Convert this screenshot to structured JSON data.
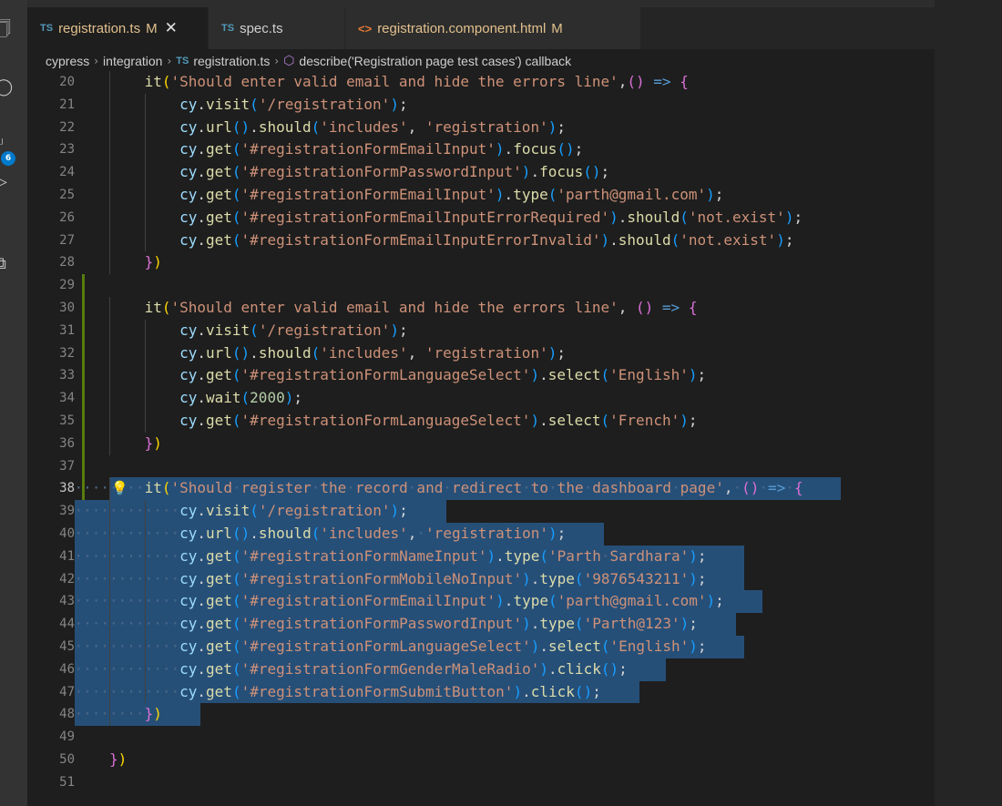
{
  "tabs": [
    {
      "badge": "TS",
      "label": "registration.ts",
      "modified": "M",
      "active": true,
      "close": "✕"
    },
    {
      "badge": "TS",
      "label": "spec.ts",
      "modified": "",
      "active": false
    },
    {
      "badge": "<>",
      "label": "registration.component.html",
      "modified": "M",
      "active": false
    }
  ],
  "breadcrumb": {
    "segments": [
      "cypress",
      "integration",
      "registration.ts",
      "describe('Registration page test cases') callback"
    ]
  },
  "activity_bar": {
    "source_control_badge": "6"
  },
  "colors": {
    "selection": "#264f78",
    "modified_tab_text": "#e2c08d",
    "gutter_modified": "#587c0c"
  },
  "editor": {
    "current_line": 38,
    "lines": [
      {
        "n": 20,
        "indent": 2,
        "tokens": [
          [
            "k",
            "it"
          ],
          [
            "p1",
            "("
          ],
          [
            "s",
            "'Should enter valid email and hide the errors line'"
          ],
          [
            "",
            ","
          ],
          [
            "p2",
            "()"
          ],
          [
            "",
            " "
          ],
          [
            "op",
            "=>"
          ],
          [
            "",
            " "
          ],
          [
            "p2",
            "{"
          ]
        ]
      },
      {
        "n": 21,
        "indent": 3,
        "tokens": [
          [
            "v",
            "cy"
          ],
          [
            "",
            "."
          ],
          [
            "k",
            "visit"
          ],
          [
            "p3",
            "("
          ],
          [
            "s",
            "'/registration'"
          ],
          [
            "p3",
            ")"
          ],
          [
            "",
            ";"
          ]
        ]
      },
      {
        "n": 22,
        "indent": 3,
        "tokens": [
          [
            "v",
            "cy"
          ],
          [
            "",
            "."
          ],
          [
            "k",
            "url"
          ],
          [
            "p3",
            "()"
          ],
          [
            "",
            "."
          ],
          [
            "k",
            "should"
          ],
          [
            "p3",
            "("
          ],
          [
            "s",
            "'includes'"
          ],
          [
            ", ",
            ""
          ],
          [
            "s",
            "'registration'"
          ],
          [
            "p3",
            ")"
          ],
          [
            "",
            ";"
          ]
        ]
      },
      {
        "n": 23,
        "indent": 3,
        "tokens": [
          [
            "v",
            "cy"
          ],
          [
            "",
            "."
          ],
          [
            "k",
            "get"
          ],
          [
            "p3",
            "("
          ],
          [
            "s",
            "'#registrationFormEmailInput'"
          ],
          [
            "p3",
            ")"
          ],
          [
            "",
            "."
          ],
          [
            "k",
            "focus"
          ],
          [
            "p3",
            "()"
          ],
          [
            "",
            ";"
          ]
        ]
      },
      {
        "n": 24,
        "indent": 3,
        "tokens": [
          [
            "v",
            "cy"
          ],
          [
            "",
            "."
          ],
          [
            "k",
            "get"
          ],
          [
            "p3",
            "("
          ],
          [
            "s",
            "'#registrationFormPasswordInput'"
          ],
          [
            "p3",
            ")"
          ],
          [
            "",
            "."
          ],
          [
            "k",
            "focus"
          ],
          [
            "p3",
            "()"
          ],
          [
            "",
            ";"
          ]
        ]
      },
      {
        "n": 25,
        "indent": 3,
        "tokens": [
          [
            "v",
            "cy"
          ],
          [
            "",
            "."
          ],
          [
            "k",
            "get"
          ],
          [
            "p3",
            "("
          ],
          [
            "s",
            "'#registrationFormEmailInput'"
          ],
          [
            "p3",
            ")"
          ],
          [
            "",
            "."
          ],
          [
            "k",
            "type"
          ],
          [
            "p3",
            "("
          ],
          [
            "s",
            "'parth@gmail.com'"
          ],
          [
            "p3",
            ")"
          ],
          [
            "",
            ";"
          ]
        ]
      },
      {
        "n": 26,
        "indent": 3,
        "tokens": [
          [
            "v",
            "cy"
          ],
          [
            "",
            "."
          ],
          [
            "k",
            "get"
          ],
          [
            "p3",
            "("
          ],
          [
            "s",
            "'#registrationFormEmailInputErrorRequired'"
          ],
          [
            "p3",
            ")"
          ],
          [
            "",
            "."
          ],
          [
            "k",
            "should"
          ],
          [
            "p3",
            "("
          ],
          [
            "s",
            "'not.exist'"
          ],
          [
            "p3",
            ")"
          ],
          [
            "",
            ";"
          ]
        ]
      },
      {
        "n": 27,
        "indent": 3,
        "tokens": [
          [
            "v",
            "cy"
          ],
          [
            "",
            "."
          ],
          [
            "k",
            "get"
          ],
          [
            "p3",
            "("
          ],
          [
            "s",
            "'#registrationFormEmailInputErrorInvalid'"
          ],
          [
            "p3",
            ")"
          ],
          [
            "",
            "."
          ],
          [
            "k",
            "should"
          ],
          [
            "p3",
            "("
          ],
          [
            "s",
            "'not.exist'"
          ],
          [
            "p3",
            ")"
          ],
          [
            "",
            ";"
          ]
        ]
      },
      {
        "n": 28,
        "indent": 2,
        "tokens": [
          [
            "p2",
            "}"
          ],
          [
            "p1",
            ")"
          ]
        ]
      },
      {
        "n": 29,
        "indent": 0,
        "tokens": []
      },
      {
        "n": 30,
        "indent": 2,
        "tokens": [
          [
            "k",
            "it"
          ],
          [
            "p1",
            "("
          ],
          [
            "s",
            "'Should enter valid email and hide the errors line'"
          ],
          [
            "",
            ", "
          ],
          [
            "p2",
            "()"
          ],
          [
            "",
            " "
          ],
          [
            "op",
            "=>"
          ],
          [
            "",
            " "
          ],
          [
            "p2",
            "{"
          ]
        ]
      },
      {
        "n": 31,
        "indent": 3,
        "tokens": [
          [
            "v",
            "cy"
          ],
          [
            "",
            "."
          ],
          [
            "k",
            "visit"
          ],
          [
            "p3",
            "("
          ],
          [
            "s",
            "'/registration'"
          ],
          [
            "p3",
            ")"
          ],
          [
            "",
            ";"
          ]
        ]
      },
      {
        "n": 32,
        "indent": 3,
        "tokens": [
          [
            "v",
            "cy"
          ],
          [
            "",
            "."
          ],
          [
            "k",
            "url"
          ],
          [
            "p3",
            "()"
          ],
          [
            "",
            "."
          ],
          [
            "k",
            "should"
          ],
          [
            "p3",
            "("
          ],
          [
            "s",
            "'includes'"
          ],
          [
            "",
            ", "
          ],
          [
            "s",
            "'registration'"
          ],
          [
            "p3",
            ")"
          ],
          [
            "",
            ";"
          ]
        ]
      },
      {
        "n": 33,
        "indent": 3,
        "tokens": [
          [
            "v",
            "cy"
          ],
          [
            "",
            "."
          ],
          [
            "k",
            "get"
          ],
          [
            "p3",
            "("
          ],
          [
            "s",
            "'#registrationFormLanguageSelect'"
          ],
          [
            "p3",
            ")"
          ],
          [
            "",
            "."
          ],
          [
            "k",
            "select"
          ],
          [
            "p3",
            "("
          ],
          [
            "s",
            "'English'"
          ],
          [
            "p3",
            ")"
          ],
          [
            "",
            ";"
          ]
        ]
      },
      {
        "n": 34,
        "indent": 3,
        "tokens": [
          [
            "v",
            "cy"
          ],
          [
            "",
            "."
          ],
          [
            "k",
            "wait"
          ],
          [
            "p3",
            "("
          ],
          [
            "n",
            "2000"
          ],
          [
            "p3",
            ")"
          ],
          [
            "",
            ";"
          ]
        ]
      },
      {
        "n": 35,
        "indent": 3,
        "tokens": [
          [
            "v",
            "cy"
          ],
          [
            "",
            "."
          ],
          [
            "k",
            "get"
          ],
          [
            "p3",
            "("
          ],
          [
            "s",
            "'#registrationFormLanguageSelect'"
          ],
          [
            "p3",
            ")"
          ],
          [
            "",
            "."
          ],
          [
            "k",
            "select"
          ],
          [
            "p3",
            "("
          ],
          [
            "s",
            "'French'"
          ],
          [
            "p3",
            ")"
          ],
          [
            "",
            ";"
          ]
        ]
      },
      {
        "n": 36,
        "indent": 2,
        "tokens": [
          [
            "p2",
            "}"
          ],
          [
            "p1",
            ")"
          ]
        ]
      },
      {
        "n": 37,
        "indent": 0,
        "tokens": []
      },
      {
        "n": 38,
        "indent": 2,
        "sel": true,
        "bulb": "💡",
        "tokens": [
          [
            "k",
            "it"
          ],
          [
            "p1",
            "("
          ],
          [
            "s",
            "'Should register the record and redirect to the dashboard page'"
          ],
          [
            "",
            ", "
          ],
          [
            "p2",
            "()"
          ],
          [
            "",
            " "
          ],
          [
            "op",
            "=>"
          ],
          [
            "",
            " "
          ],
          [
            "p2",
            "{"
          ]
        ]
      },
      {
        "n": 39,
        "indent": 3,
        "sel": true,
        "tokens": [
          [
            "v",
            "cy"
          ],
          [
            "",
            "."
          ],
          [
            "k",
            "visit"
          ],
          [
            "p3",
            "("
          ],
          [
            "s",
            "'/registration'"
          ],
          [
            "p3",
            ")"
          ],
          [
            "",
            ";"
          ]
        ]
      },
      {
        "n": 40,
        "indent": 3,
        "sel": true,
        "tokens": [
          [
            "v",
            "cy"
          ],
          [
            "",
            "."
          ],
          [
            "k",
            "url"
          ],
          [
            "p3",
            "()"
          ],
          [
            "",
            "."
          ],
          [
            "k",
            "should"
          ],
          [
            "p3",
            "("
          ],
          [
            "s",
            "'includes'"
          ],
          [
            "",
            ", "
          ],
          [
            "s",
            "'registration'"
          ],
          [
            "p3",
            ")"
          ],
          [
            "",
            ";"
          ]
        ]
      },
      {
        "n": 41,
        "indent": 3,
        "sel": true,
        "tokens": [
          [
            "v",
            "cy"
          ],
          [
            "",
            "."
          ],
          [
            "k",
            "get"
          ],
          [
            "p3",
            "("
          ],
          [
            "s",
            "'#registrationFormNameInput'"
          ],
          [
            "p3",
            ")"
          ],
          [
            "",
            "."
          ],
          [
            "k",
            "type"
          ],
          [
            "p3",
            "("
          ],
          [
            "s",
            "'Parth Sardhara'"
          ],
          [
            "p3",
            ")"
          ],
          [
            "",
            ";"
          ]
        ]
      },
      {
        "n": 42,
        "indent": 3,
        "sel": true,
        "tokens": [
          [
            "v",
            "cy"
          ],
          [
            "",
            "."
          ],
          [
            "k",
            "get"
          ],
          [
            "p3",
            "("
          ],
          [
            "s",
            "'#registrationFormMobileNoInput'"
          ],
          [
            "p3",
            ")"
          ],
          [
            "",
            "."
          ],
          [
            "k",
            "type"
          ],
          [
            "p3",
            "("
          ],
          [
            "s",
            "'9876543211'"
          ],
          [
            "p3",
            ")"
          ],
          [
            "",
            ";"
          ]
        ]
      },
      {
        "n": 43,
        "indent": 3,
        "sel": true,
        "tokens": [
          [
            "v",
            "cy"
          ],
          [
            "",
            "."
          ],
          [
            "k",
            "get"
          ],
          [
            "p3",
            "("
          ],
          [
            "s",
            "'#registrationFormEmailInput'"
          ],
          [
            "p3",
            ")"
          ],
          [
            "",
            "."
          ],
          [
            "k",
            "type"
          ],
          [
            "p3",
            "("
          ],
          [
            "s",
            "'parth@gmail.com'"
          ],
          [
            "p3",
            ")"
          ],
          [
            "",
            ";"
          ]
        ]
      },
      {
        "n": 44,
        "indent": 3,
        "sel": true,
        "tokens": [
          [
            "v",
            "cy"
          ],
          [
            "",
            "."
          ],
          [
            "k",
            "get"
          ],
          [
            "p3",
            "("
          ],
          [
            "s",
            "'#registrationFormPasswordInput'"
          ],
          [
            "p3",
            ")"
          ],
          [
            "",
            "."
          ],
          [
            "k",
            "type"
          ],
          [
            "p3",
            "("
          ],
          [
            "s",
            "'Parth@123'"
          ],
          [
            "p3",
            ")"
          ],
          [
            "",
            ";"
          ]
        ]
      },
      {
        "n": 45,
        "indent": 3,
        "sel": true,
        "tokens": [
          [
            "v",
            "cy"
          ],
          [
            "",
            "."
          ],
          [
            "k",
            "get"
          ],
          [
            "p3",
            "("
          ],
          [
            "s",
            "'#registrationFormLanguageSelect'"
          ],
          [
            "p3",
            ")"
          ],
          [
            "",
            "."
          ],
          [
            "k",
            "select"
          ],
          [
            "p3",
            "("
          ],
          [
            "s",
            "'English'"
          ],
          [
            "p3",
            ")"
          ],
          [
            "",
            ";"
          ]
        ]
      },
      {
        "n": 46,
        "indent": 3,
        "sel": true,
        "tokens": [
          [
            "v",
            "cy"
          ],
          [
            "",
            "."
          ],
          [
            "k",
            "get"
          ],
          [
            "p3",
            "("
          ],
          [
            "s",
            "'#registrationFormGenderMaleRadio'"
          ],
          [
            "p3",
            ")"
          ],
          [
            "",
            "."
          ],
          [
            "k",
            "click"
          ],
          [
            "p3",
            "()"
          ],
          [
            "",
            ";"
          ]
        ]
      },
      {
        "n": 47,
        "indent": 3,
        "sel": true,
        "tokens": [
          [
            "v",
            "cy"
          ],
          [
            "",
            "."
          ],
          [
            "k",
            "get"
          ],
          [
            "p3",
            "("
          ],
          [
            "s",
            "'#registrationFormSubmitButton'"
          ],
          [
            "p3",
            ")"
          ],
          [
            "",
            "."
          ],
          [
            "k",
            "click"
          ],
          [
            "p3",
            "()"
          ],
          [
            "",
            ";"
          ]
        ]
      },
      {
        "n": 48,
        "indent": 2,
        "sel": true,
        "tokens": [
          [
            "p2",
            "}"
          ],
          [
            "p1",
            ")"
          ]
        ]
      },
      {
        "n": 49,
        "indent": 0,
        "tokens": []
      },
      {
        "n": 50,
        "indent": 1,
        "tokens": [
          [
            "p2",
            "}"
          ],
          [
            "p1",
            ")"
          ]
        ]
      },
      {
        "n": 51,
        "indent": 0,
        "tokens": []
      }
    ]
  }
}
